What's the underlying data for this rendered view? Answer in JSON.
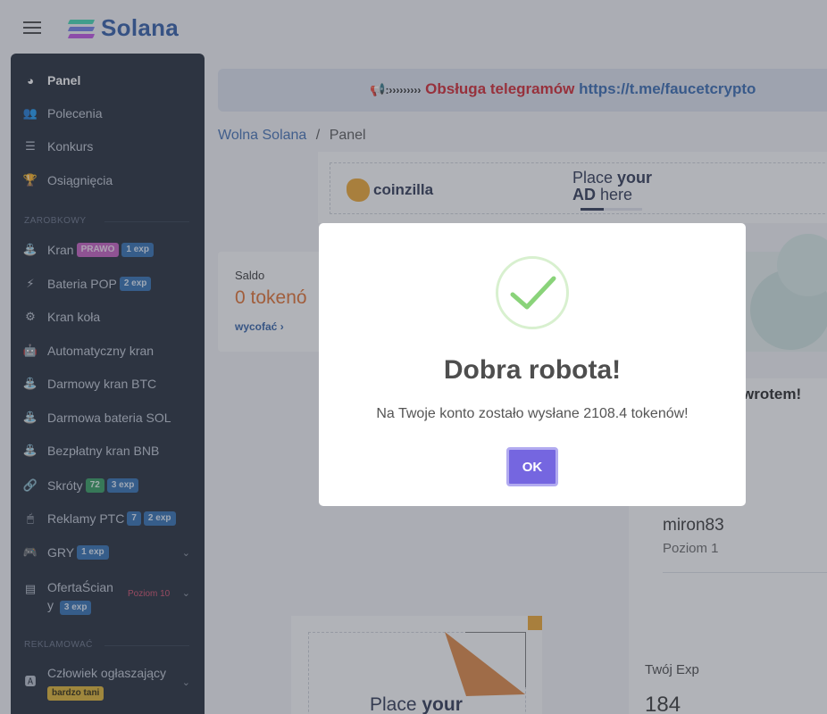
{
  "brand": {
    "name": "Solana"
  },
  "banner": {
    "arrows": ":›››››››››",
    "telegram_label": "Obsługa telegramów",
    "telegram_link": "https://t.me/faucetcrypto"
  },
  "breadcrumb": {
    "home": "Wolna Solana",
    "separator": "/",
    "current": "Panel"
  },
  "sidebar": {
    "items": [
      {
        "label": "Panel"
      },
      {
        "label": "Polecenia"
      },
      {
        "label": "Konkurs"
      },
      {
        "label": "Osiągnięcia"
      }
    ],
    "section_earn": "ZAROBKOWY",
    "earn_items": [
      {
        "label": "Kran",
        "badge1": "PRAWO",
        "badge2": "1 exp"
      },
      {
        "label": "Bateria POP",
        "badge1": "2 exp"
      },
      {
        "label": "Kran koła"
      },
      {
        "label": "Automatyczny kran"
      },
      {
        "label": "Darmowy kran BTC"
      },
      {
        "label": "Darmowa bateria SOL"
      },
      {
        "label": "Bezpłatny kran BNB"
      },
      {
        "label": "Skróty",
        "badge1": "72",
        "badge2": "3 exp"
      },
      {
        "label": "Reklamy PTC",
        "badge1": "7",
        "badge2": "2 exp"
      },
      {
        "label": "GRY",
        "badge1": "1 exp"
      },
      {
        "label_line1": "OfertaŚcian",
        "label_line2": "y",
        "badge1": "3 exp",
        "level": "Poziom 10"
      }
    ],
    "section_ads": "REKLAMOWAĆ",
    "ads_items": [
      {
        "label": "Człowiek ogłaszający",
        "badge1": "bardzo tani"
      }
    ]
  },
  "ad_top": {
    "brand": "coinzilla",
    "place_line1_a": "Place ",
    "place_line1_b": "your",
    "place_line2_a": "AD",
    "place_line2_b": " here"
  },
  "saldo": {
    "label": "Saldo",
    "value": "0 tokenó",
    "link": "wycofać ›"
  },
  "welcome": {
    "text": "wrotem!",
    "username": "miron83",
    "level": "Poziom 1",
    "exp_label": "Twój Exp",
    "exp_value": "184"
  },
  "ad_bottom": {
    "place_a": "Place ",
    "place_b": "your"
  },
  "modal": {
    "title": "Dobra robota!",
    "message": "Na Twoje konto zostało wysłane 2108.4 tokenów!",
    "ok": "OK"
  },
  "colors": {
    "accent": "#7566e0",
    "sidebar_bg": "#1d2532",
    "brand_blue": "#2b58a6",
    "saldo_orange": "#e36d2a",
    "check_green": "#8ad37a"
  }
}
